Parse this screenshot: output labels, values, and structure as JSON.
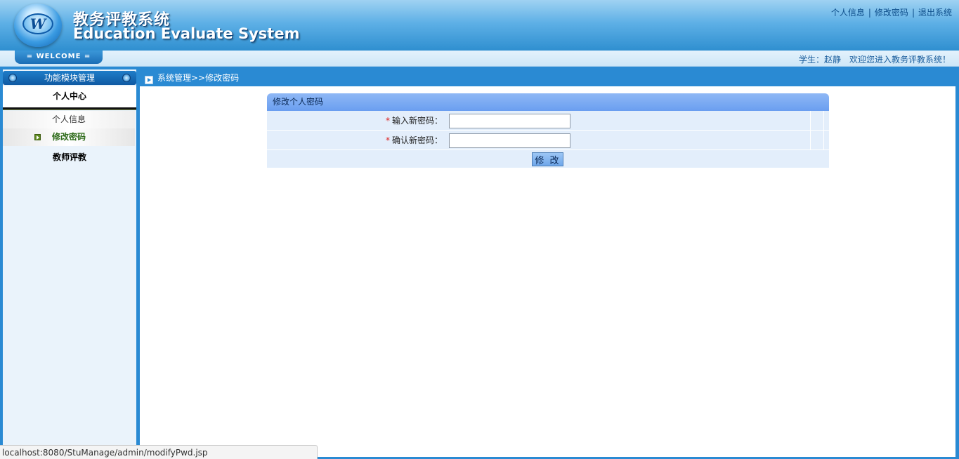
{
  "header": {
    "logo_letter": "W",
    "title_cn": "教务评教系统",
    "title_en": "Education Evaluate System",
    "links": [
      "个人信息",
      "修改密码",
      "退出系统"
    ],
    "link_separator": "|"
  },
  "welcome_bar": {
    "tab_label": "= WELCOME =",
    "user_label": "学生：赵静",
    "greeting": "欢迎您进入教务评教系统！"
  },
  "sidebar": {
    "title": "功能模块管理",
    "section": "个人中心",
    "items": [
      {
        "label": "个人信息"
      },
      {
        "label": "修改密码"
      }
    ],
    "section2": "教师评教"
  },
  "breadcrumb": "系统管理>>修改密码",
  "form": {
    "title": "修改个人密码",
    "fields": [
      {
        "required_mark": "*",
        "label": "输入新密码：",
        "value": ""
      },
      {
        "required_mark": "*",
        "label": "确认新密码：",
        "value": ""
      }
    ],
    "submit_label": "修 改"
  },
  "status_bar": "localhost:8080/StuManage/admin/modifyPwd.jsp"
}
